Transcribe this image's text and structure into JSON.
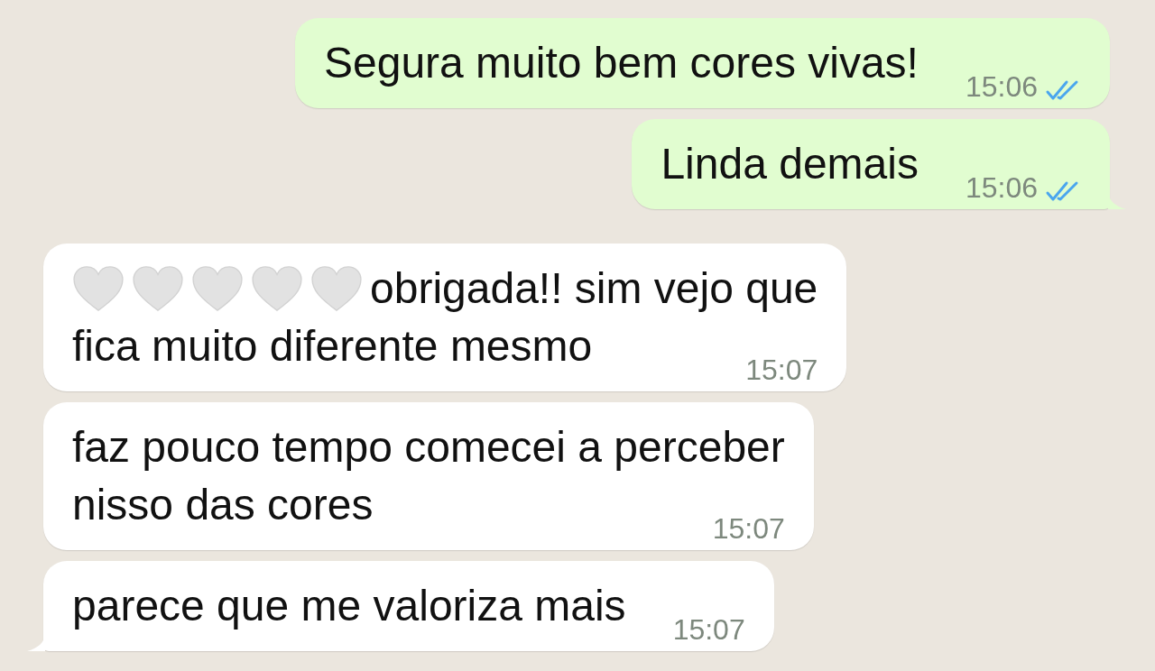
{
  "messages": [
    {
      "kind": "outgoing",
      "lines": [
        {
          "segments": [
            {
              "kind": "text",
              "text": "Segura muito bem cores vivas!"
            }
          ]
        }
      ],
      "time": "15:06",
      "read": true,
      "tail": false
    },
    {
      "kind": "outgoing",
      "lines": [
        {
          "segments": [
            {
              "kind": "text",
              "text": "Linda demais"
            }
          ]
        }
      ],
      "time": "15:06",
      "read": true,
      "tail": true
    },
    {
      "kind": "incoming",
      "lines": [
        {
          "segments": [
            {
              "kind": "heart"
            },
            {
              "kind": "heart"
            },
            {
              "kind": "heart"
            },
            {
              "kind": "heart"
            },
            {
              "kind": "heart"
            },
            {
              "kind": "text",
              "text": "obrigada!! sim vejo que"
            }
          ]
        },
        {
          "segments": [
            {
              "kind": "text",
              "text": "fica muito diferente mesmo"
            }
          ]
        }
      ],
      "time": "15:07",
      "tail": false
    },
    {
      "kind": "incoming",
      "lines": [
        {
          "segments": [
            {
              "kind": "text",
              "text": "faz pouco tempo comecei a perceber"
            }
          ]
        },
        {
          "segments": [
            {
              "kind": "text",
              "text": "nisso das cores"
            }
          ]
        }
      ],
      "time": "15:07",
      "tail": false
    },
    {
      "kind": "incoming",
      "lines": [
        {
          "segments": [
            {
              "kind": "text",
              "text": "parece que me valoriza mais"
            }
          ]
        }
      ],
      "time": "15:07",
      "tail": true
    }
  ]
}
